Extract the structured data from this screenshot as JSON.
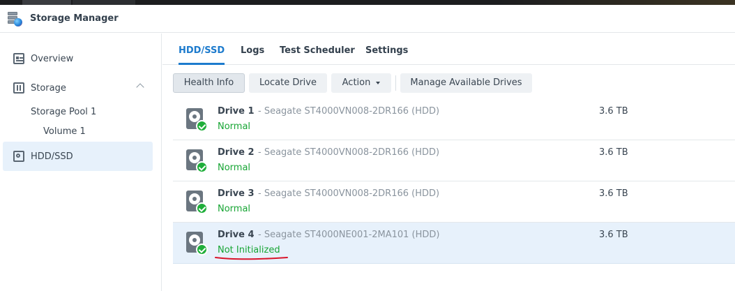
{
  "app": {
    "title": "Storage Manager"
  },
  "sidebar": {
    "items": [
      {
        "label": "Overview",
        "icon": "overview-icon"
      },
      {
        "label": "Storage",
        "icon": "storage-icon"
      },
      {
        "label": "HDD/SSD",
        "icon": "hdd-icon"
      }
    ],
    "pool": "Storage Pool 1",
    "volume": "Volume 1"
  },
  "tabs": [
    "HDD/SSD",
    "Logs",
    "Test Scheduler",
    "Settings"
  ],
  "toolbar": {
    "health_info": "Health Info",
    "locate_drive": "Locate Drive",
    "action": "Action",
    "manage": "Manage Available Drives"
  },
  "drives": [
    {
      "name": "Drive 1",
      "model": "- Seagate ST4000VN008-2DR166 (HDD)",
      "status": "Normal",
      "size": "3.6 TB"
    },
    {
      "name": "Drive 2",
      "model": "- Seagate ST4000VN008-2DR166 (HDD)",
      "status": "Normal",
      "size": "3.6 TB"
    },
    {
      "name": "Drive 3",
      "model": "- Seagate ST4000VN008-2DR166 (HDD)",
      "status": "Normal",
      "size": "3.6 TB"
    },
    {
      "name": "Drive 4",
      "model": "- Seagate ST4000NE001-2MA101 (HDD)",
      "status": "Not Initialized",
      "size": "3.6 TB"
    }
  ],
  "colors": {
    "accent": "#1d7bcd",
    "status_ok": "#17a534",
    "annotation": "#d9142a",
    "selected_row": "#e7f1fb"
  }
}
